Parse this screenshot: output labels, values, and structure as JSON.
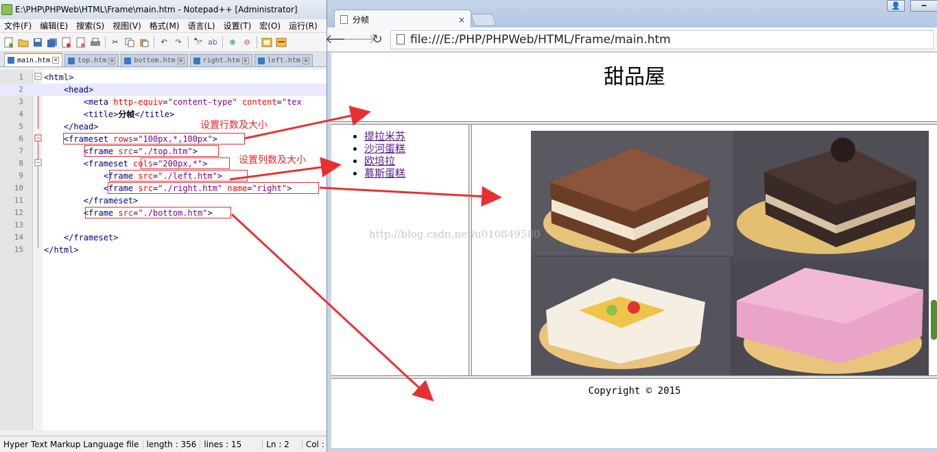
{
  "notepad": {
    "title": "E:\\PHP\\PHPWeb\\HTML\\Frame\\main.htm - Notepad++ [Administrator]",
    "menu": [
      "文件(F)",
      "编辑(E)",
      "搜索(S)",
      "视图(V)",
      "格式(M)",
      "语言(L)",
      "设置(T)",
      "宏(O)",
      "运行(R)"
    ],
    "tabs": [
      "main.htm",
      "top.htm",
      "bottom.htm",
      "right.htm",
      "left.htm"
    ],
    "lines": [
      {
        "n": "1"
      },
      {
        "n": "2"
      },
      {
        "n": "3"
      },
      {
        "n": "4"
      },
      {
        "n": "5"
      },
      {
        "n": "6"
      },
      {
        "n": "7"
      },
      {
        "n": "8"
      },
      {
        "n": "9"
      },
      {
        "n": "10"
      },
      {
        "n": "11"
      },
      {
        "n": "12"
      },
      {
        "n": "13"
      },
      {
        "n": "14"
      },
      {
        "n": "15"
      }
    ],
    "title_text": "分帧",
    "status": {
      "lang": "Hyper Text Markup Language file",
      "length": "length : 356",
      "lines": "lines : 15",
      "ln": "Ln : 2",
      "col": "Col :"
    }
  },
  "annotations": {
    "rows_note": "设置行数及大小",
    "cols_note": "设置列数及大小"
  },
  "browser": {
    "tab_title": "分帧",
    "tab_close": "×",
    "url": "file:///E:/PHP/PHPWeb/HTML/Frame/main.htm",
    "top_heading": "甜品屋",
    "menu_links": [
      "提拉米苏",
      "沙河蛋糕",
      "欧培拉",
      "慕斯蛋糕"
    ],
    "copyright": "Copyright © 2015",
    "watermark": "http://blog.csdn.net/u010849580"
  }
}
